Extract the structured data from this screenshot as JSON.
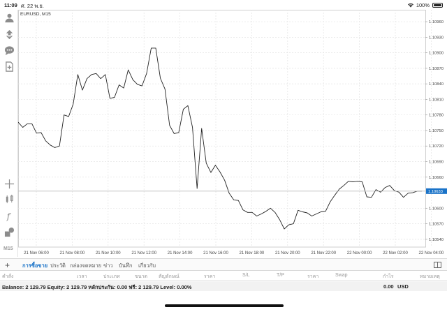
{
  "status_bar": {
    "time": "11:09",
    "date": "ศ. 22 พ.ย.",
    "battery": "100%"
  },
  "chart": {
    "title": "EURUSD, M15",
    "current_price_label": "1.10633"
  },
  "toolbar": {
    "timeframe": "M15",
    "icons": [
      "account-icon",
      "trade-icon",
      "chat-icon",
      "add-document-icon",
      "crosshair-icon",
      "indicators-icon",
      "function-icon",
      "objects-icon"
    ]
  },
  "chart_data": {
    "type": "line",
    "series": [
      {
        "values": [
          1.10766,
          1.10756,
          1.10763,
          1.10763,
          1.10745,
          1.10746,
          1.1073,
          1.10722,
          1.10717,
          1.1072,
          1.1078,
          1.10777,
          1.10801,
          1.10858,
          1.10828,
          1.1085,
          1.10858,
          1.1086,
          1.1085,
          1.10858,
          1.10812,
          1.10814,
          1.10838,
          1.10832,
          1.10867,
          1.10848,
          1.10839,
          1.10836,
          1.1086,
          1.10909,
          1.10909,
          1.10851,
          1.1083,
          1.1076,
          1.10744,
          1.10746,
          1.10791,
          1.10798,
          1.10756,
          1.10638,
          1.10754,
          1.10687,
          1.10669,
          1.10683,
          1.1067,
          1.10654,
          1.10629,
          1.10616,
          1.10615,
          1.10597,
          1.10592,
          1.10592,
          1.10585,
          1.10589,
          1.10594,
          1.106,
          1.10592,
          1.10578,
          1.1056,
          1.10568,
          1.1057,
          1.10596,
          1.10593,
          1.10591,
          1.10585,
          1.10589,
          1.10593,
          1.10594,
          1.10612,
          1.10625,
          1.10637,
          1.10644,
          1.10652,
          1.10651,
          1.10652,
          1.10651,
          1.10622,
          1.10621,
          1.10636,
          1.10631,
          1.1064,
          1.10644,
          1.10634,
          1.10631,
          1.10621,
          1.10629,
          1.1063,
          1.10633,
          1.10633
        ]
      }
    ],
    "x_ticks": [
      "21 Nov 06:00",
      "21 Nov 08:00",
      "21 Nov 10:00",
      "21 Nov 12:00",
      "21 Nov 14:00",
      "21 Nov 16:00",
      "21 Nov 18:00",
      "21 Nov 20:00",
      "21 Nov 22:00",
      "22 Nov 00:00",
      "22 Nov 02:00",
      "22 Nov 04:00"
    ],
    "y_ticks": [
      "1.10960",
      "1.10930",
      "1.10900",
      "1.10870",
      "1.10840",
      "1.10810",
      "1.10780",
      "1.10750",
      "1.10720",
      "1.10690",
      "1.10660",
      "1.10600",
      "1.10570",
      "1.10540"
    ],
    "ylim": [
      1.10525,
      1.10983
    ],
    "grid": true,
    "line_color": "#222222"
  },
  "tabs": {
    "add_label": "+",
    "items": [
      {
        "label": "การซื้อขาย",
        "active": true
      },
      {
        "label": "ประวัติ",
        "active": false
      },
      {
        "label": "กล่องจดหมาย",
        "active": false
      },
      {
        "label": "ข่าว",
        "active": false
      },
      {
        "label": "บันทึก",
        "active": false
      },
      {
        "label": "เกี่ยวกับ",
        "active": false
      }
    ]
  },
  "columns": [
    "คำสั่ง",
    "เวลา",
    "ประเภท",
    "ขนาด",
    "สัญลักษณ์",
    "ราคา",
    "S/L",
    "T/P",
    "ราคา",
    "Swap",
    "กำไร",
    "หมายเหตุ"
  ],
  "account": {
    "summary": "Balance: 2 129.79 Equity: 2 129.79 หลักประกัน: 0.00 ฟรี: 2 129.79 Level: 0.00%",
    "profit": "0.00",
    "currency": "USD"
  },
  "colors": {
    "accent": "#1a73c8",
    "grid": "#e3e3e3",
    "price_line": "#bcbcbc",
    "price_tag": "#1a73c8"
  }
}
